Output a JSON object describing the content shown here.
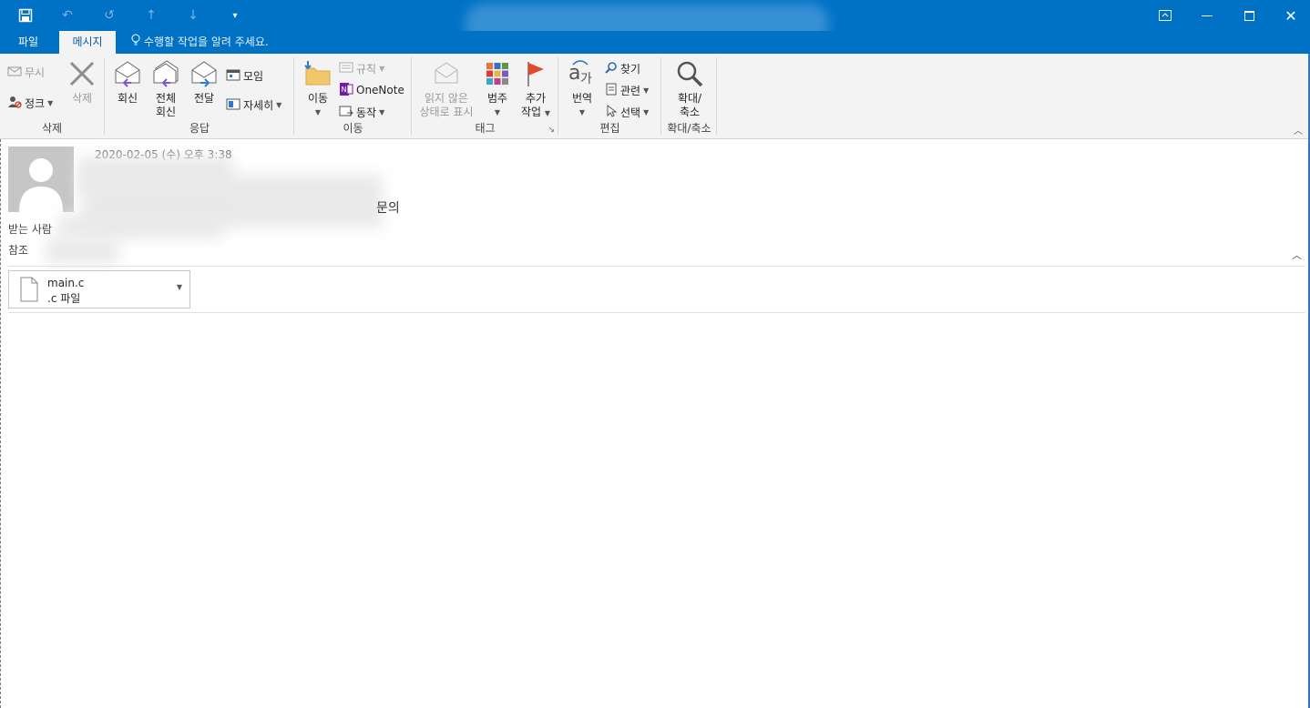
{
  "titlebar": {
    "bg_color": "#0072c6",
    "qat_icons": [
      "save-icon",
      "undo-icon",
      "redo-icon",
      "previous-item-icon",
      "next-item-icon",
      "customize-qat-icon"
    ],
    "window_icons": [
      "ribbon-display-options-icon",
      "minimize-icon",
      "maximize-icon",
      "close-icon"
    ]
  },
  "tabs": [
    {
      "label": "파일"
    },
    {
      "label": "메시지"
    }
  ],
  "tell_me": "수행할 작업을 알려 주세요.",
  "ribbon": {
    "delete_group": {
      "ignore": "무시",
      "junk": "정크",
      "delete": "삭제",
      "label": "삭제"
    },
    "respond_group": {
      "reply": "회신",
      "reply_all_1": "전체",
      "reply_all_2": "회신",
      "forward": "전달",
      "meeting": "모임",
      "more": "자세히",
      "label": "응답"
    },
    "move_group": {
      "move": "이동",
      "rules": "규칙",
      "onenote": "OneNote",
      "actions": "동작",
      "label": "이동"
    },
    "tags_group": {
      "unread_1": "읽지 않은",
      "unread_2": "상태로 표시",
      "categorize": "범주",
      "followup_1": "추가",
      "followup_2": "작업",
      "label": "태그"
    },
    "editing_group": {
      "translate": "번역",
      "find": "찾기",
      "related": "관련",
      "select": "선택",
      "label": "편집"
    },
    "zoom_group": {
      "zoom_1": "확대/",
      "zoom_2": "축소",
      "label": "확대/축소"
    }
  },
  "message": {
    "date": "2020-02-05 (수) 오후 3:38",
    "subject_tail": "문의",
    "to_label": "받는 사람",
    "cc_label": "참조"
  },
  "attachment": {
    "name": "main.c",
    "type": ".c 파일"
  }
}
